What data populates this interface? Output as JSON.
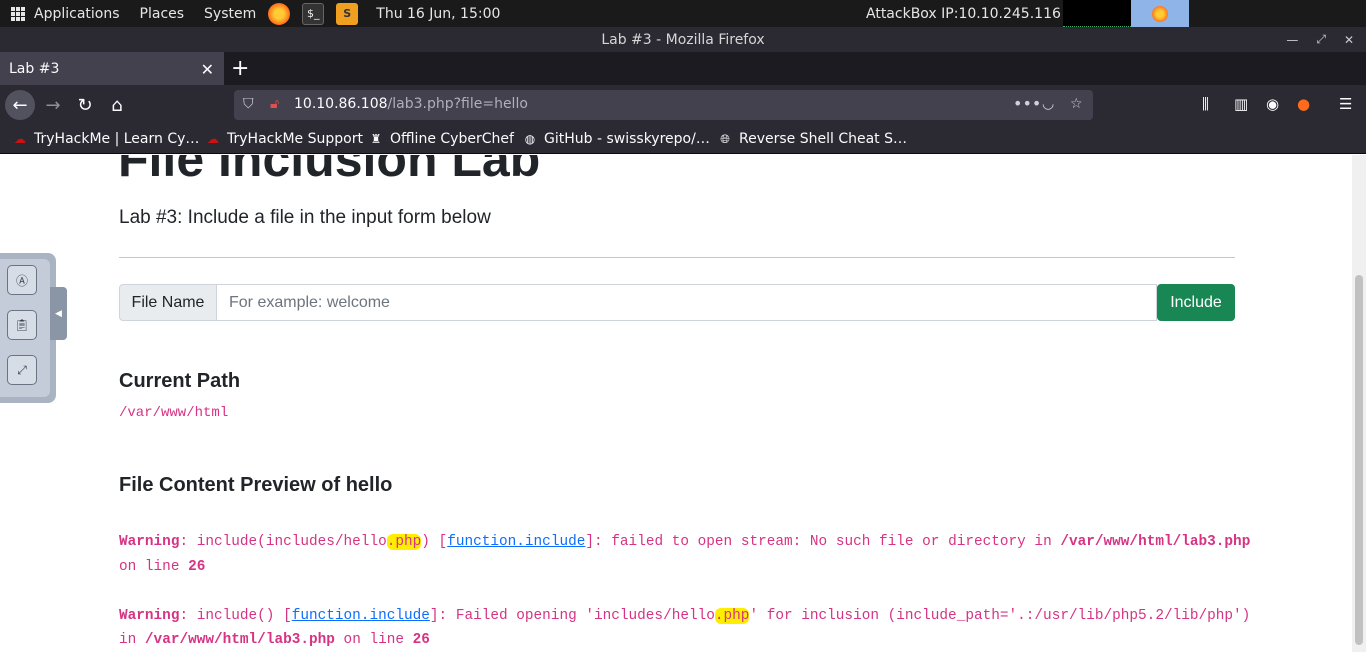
{
  "panel": {
    "applications": "Applications",
    "places": "Places",
    "system": "System",
    "clock": "Thu 16 Jun, 15:00",
    "attackbox": "AttackBox IP:10.10.245.116",
    "terminal_glyph": "$_"
  },
  "window": {
    "title": "Lab #3 - Mozilla Firefox"
  },
  "tabs": [
    {
      "label": "Lab #3",
      "active": true
    }
  ],
  "navbar": {
    "url_host": "10.10.86.108",
    "url_path": "/lab3.php?file=hello"
  },
  "bookmarks": [
    {
      "label": "TryHackMe | Learn Cy…",
      "icon": "tryhackme-icon"
    },
    {
      "label": "TryHackMe Support",
      "icon": "tryhackme-icon"
    },
    {
      "label": "Offline CyberChef",
      "icon": "chef-icon"
    },
    {
      "label": "GitHub - swisskyrepo/…",
      "icon": "github-icon"
    },
    {
      "label": "Reverse Shell Cheat S…",
      "icon": "globe-icon"
    }
  ],
  "page": {
    "heading": "File Inclusion Lab",
    "lead": "Lab #3: Include a file in the input form below",
    "input_label": "File Name",
    "input_placeholder": "For example: welcome",
    "input_value": "",
    "include_button": "Include",
    "current_path_heading": "Current Path",
    "current_path": "/var/www/html",
    "preview_prefix": "File Content Preview of ",
    "preview_file": "hello",
    "warnings": [
      {
        "label": "Warning",
        "line1_a": ": include(includes/hello",
        "line1_hl": ".php",
        "line1_b": ") [",
        "link": "function.include",
        "line1_c": "]: failed to open stream: No such file or directory in ",
        "path": "/var/www/html/lab3.php",
        "line2_a": "on line ",
        "line_no": "26"
      },
      {
        "label": "Warning",
        "line1_a": ": include() [",
        "link": "function.include",
        "line1_b": "]: Failed opening 'includes/hello",
        "line1_hl": ".php",
        "line1_c": "' for inclusion (include_path='.:/usr/lib/php5.2/lib/php')",
        "line2_a": "in ",
        "path": "/var/www/html/lab3.php",
        "line2_b": " on line ",
        "line_no": "26"
      }
    ]
  },
  "colors": {
    "accent_green": "#198754",
    "code_pink": "#d63384",
    "link_blue": "#0d6efd",
    "highlight": "#ffee00"
  }
}
